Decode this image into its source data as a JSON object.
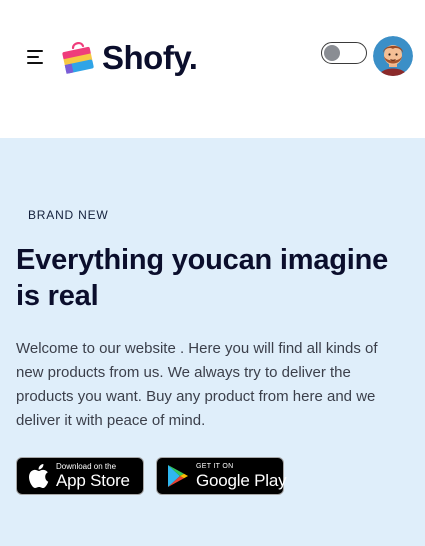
{
  "header": {
    "menu_icon": "hamburger-menu-icon",
    "logo_text": "Shofy.",
    "logo_icon": "shopping-bag-logo-icon",
    "theme_toggle": {
      "state": "off",
      "knob_color": "#8a8d93"
    },
    "avatar_icon": "user-avatar-icon"
  },
  "hero": {
    "background": "#dfeefa",
    "eyebrow": "BRAND NEW",
    "title": "Everything youcan imagine is real",
    "description": "Welcome to our website . Here you will find all kinds of new products from us. We always try to deliver the products you want. Buy any product from here and we deliver it with peace of mind.",
    "app_store": {
      "icon": "apple-icon",
      "small_label": "Download on the",
      "big_label": "App Store"
    },
    "google_play": {
      "icon": "google-play-icon",
      "small_label": "GET IT ON",
      "big_label": "Google Play"
    }
  },
  "colors": {
    "brand_dark": "#0b0e2c",
    "logo_pink": "#ef3c7b",
    "logo_yellow": "#f7c843",
    "logo_blue": "#2fa4e7"
  }
}
